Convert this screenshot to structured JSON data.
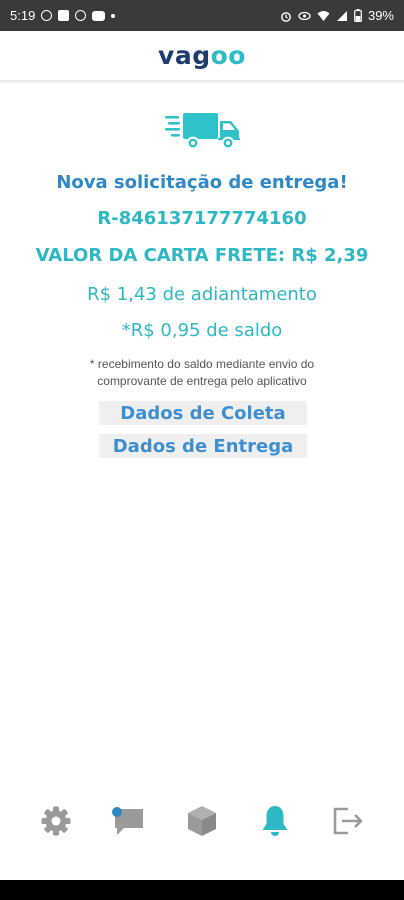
{
  "status_bar": {
    "time": "5:19",
    "battery": "39%"
  },
  "app": {
    "logo_part1": "vag",
    "logo_part2": "oo"
  },
  "request": {
    "title": "Nova solicitação de entrega!",
    "code": "R-846137177774160",
    "freight_value": "VALOR DA CARTA FRETE: R$ 2,39",
    "advance": "R$ 1,43 de adiantamento",
    "balance": "*R$ 0,95 de saldo",
    "note_line1": "* recebimento do saldo mediante envio do",
    "note_line2": "comprovante de entrega pelo aplicativo"
  },
  "sections": {
    "pickup_label": "Dados de Coleta",
    "delivery_label": "Dados de Entrega"
  },
  "bottom_nav": {
    "items": [
      "settings-icon",
      "chat-icon",
      "package-icon",
      "bell-icon",
      "logout-icon"
    ],
    "active": "bell-icon",
    "chat_has_notification": true
  },
  "colors": {
    "primary_blue": "#2f88c5",
    "teal": "#2db8c4",
    "logo_dark": "#1d3b6b",
    "icon_grey": "#9a9a9a"
  }
}
